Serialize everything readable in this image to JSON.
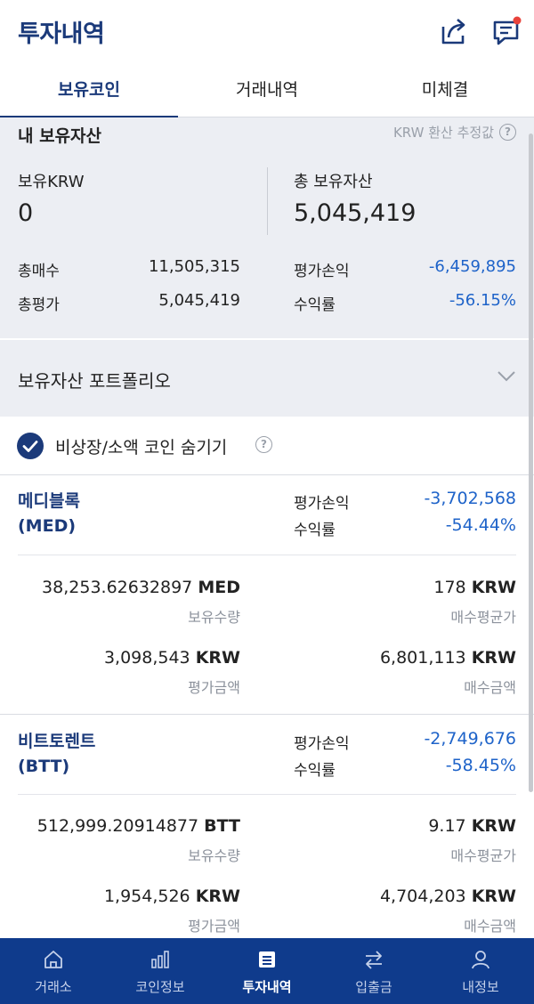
{
  "header": {
    "title": "투자내역",
    "share_icon": "share-icon",
    "chat_icon": "chat-icon"
  },
  "tabs": [
    {
      "label": "보유코인",
      "active": true
    },
    {
      "label": "거래내역",
      "active": false
    },
    {
      "label": "미체결",
      "active": false
    }
  ],
  "asset": {
    "section_title": "내 보유자산",
    "krw_note": "KRW 환산 추정값",
    "krw_label": "보유KRW",
    "krw_value": "0",
    "total_label": "총 보유자산",
    "total_value": "5,045,419",
    "buy_label": "총매수",
    "buy_value": "11,505,315",
    "eval_label": "총평가",
    "eval_value": "5,045,419",
    "pl_label": "평가손익",
    "pl_value": "-6,459,895",
    "rate_label": "수익률",
    "rate_value": "-56.15%"
  },
  "portfolio": {
    "label": "보유자산 포트폴리오"
  },
  "hide_small": {
    "label": "비상장/소액 코인 숨기기",
    "checked": true
  },
  "coins": [
    {
      "name": "메디블록",
      "symbol": "(MED)",
      "pl_label": "평가손익",
      "pl_value": "-3,702,568",
      "rate_label": "수익률",
      "rate_value": "-54.44%",
      "qty": "38,253.62632897",
      "qty_unit": "MED",
      "qty_label": "보유수량",
      "avg": "178",
      "avg_unit": "KRW",
      "avg_label": "매수평균가",
      "eval": "3,098,543",
      "eval_unit": "KRW",
      "eval_label": "평가금액",
      "buy": "6,801,113",
      "buy_unit": "KRW",
      "buy_label": "매수금액"
    },
    {
      "name": "비트토렌트",
      "symbol": "(BTT)",
      "pl_label": "평가손익",
      "pl_value": "-2,749,676",
      "rate_label": "수익률",
      "rate_value": "-58.45%",
      "qty": "512,999.20914877",
      "qty_unit": "BTT",
      "qty_label": "보유수량",
      "avg": "9.17",
      "avg_unit": "KRW",
      "avg_label": "매수평균가",
      "eval": "1,954,526",
      "eval_unit": "KRW",
      "eval_label": "평가금액",
      "buy": "4,704,203",
      "buy_unit": "KRW",
      "buy_label": "매수금액"
    }
  ],
  "nav": [
    {
      "label": "거래소",
      "icon": "home-icon",
      "active": false
    },
    {
      "label": "코인정보",
      "icon": "bar-chart-icon",
      "active": false
    },
    {
      "label": "투자내역",
      "icon": "list-icon",
      "active": true
    },
    {
      "label": "입출금",
      "icon": "transfer-icon",
      "active": false
    },
    {
      "label": "내정보",
      "icon": "user-icon",
      "active": false
    }
  ],
  "colors": {
    "brand": "#1b3a7a",
    "nav_bg": "#0f3b8c",
    "loss_blue": "#1e63c9",
    "panel_bg": "#eceef3"
  }
}
